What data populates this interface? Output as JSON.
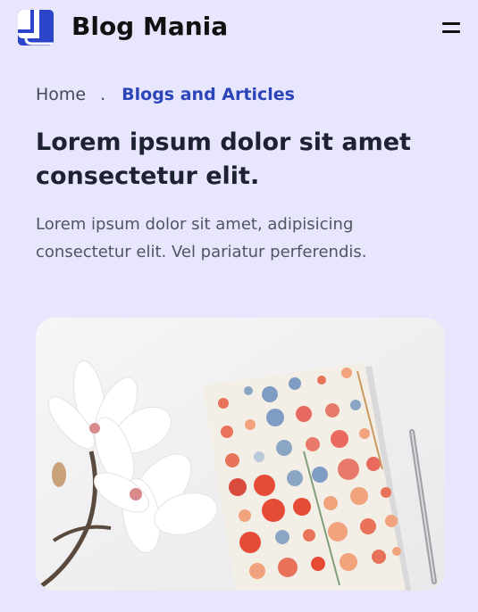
{
  "header": {
    "brand": "Blog Mania",
    "logo_icon": "logo-icon",
    "menu_icon": "hamburger-menu-icon",
    "accent": "#2b44c9"
  },
  "breadcrumb": {
    "home": "Home",
    "separator": ".",
    "current": "Blogs and Articles"
  },
  "article": {
    "title": "Lorem ipsum dolor sit amet consectetur elit.",
    "subtitle": "Lorem ipsum dolor sit amet, adipisicing consectetur elit. Vel pariatur perferendis.",
    "image_subject": "floral-notebook-magnolia-pen-photo"
  },
  "colors": {
    "background": "#e7e6fd",
    "breadcrumb_active": "#2b44b8",
    "title": "#1c2230",
    "body_text": "#50555f"
  }
}
